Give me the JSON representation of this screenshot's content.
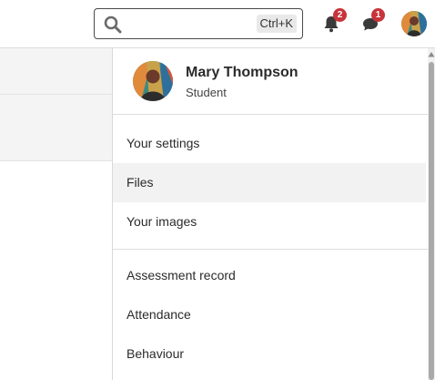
{
  "search": {
    "shortcut": "Ctrl+K"
  },
  "notifications": {
    "count": "2"
  },
  "messages": {
    "count": "1"
  },
  "profile": {
    "name": "Mary Thompson",
    "role": "Student"
  },
  "menu": {
    "items": [
      {
        "label": "Your settings"
      },
      {
        "label": "Files"
      },
      {
        "label": "Your images"
      },
      {
        "label": "Assessment record"
      },
      {
        "label": "Attendance"
      },
      {
        "label": "Behaviour"
      }
    ]
  },
  "colors": {
    "badge": "#c8343a",
    "hover": "#f2f2f2",
    "scrollbar": "#a9a9a9"
  },
  "icons": [
    "search-icon",
    "bell-icon",
    "chat-icon",
    "avatar"
  ]
}
